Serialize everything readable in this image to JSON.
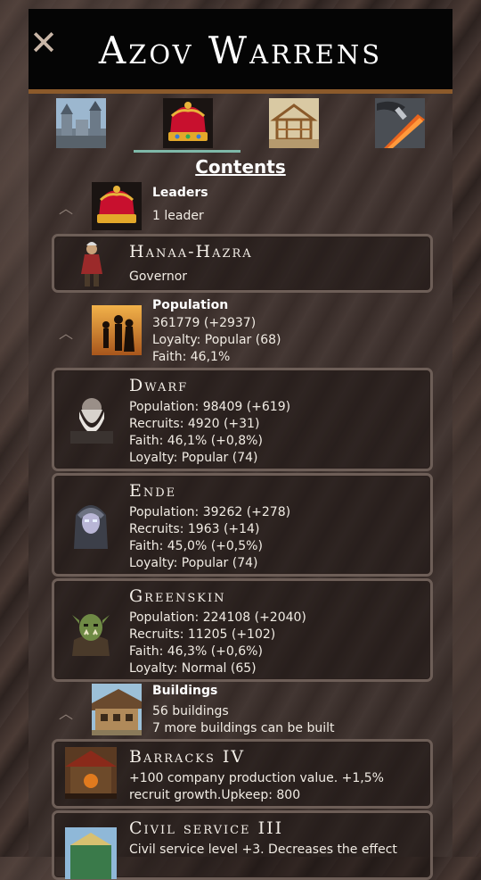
{
  "header": {
    "title": "Azov Warrens",
    "close_icon": "close-icon"
  },
  "tabs": [
    {
      "icon": "castle-icon"
    },
    {
      "icon": "crown-icon",
      "selected": true
    },
    {
      "icon": "building-frame-icon"
    },
    {
      "icon": "sword-icon"
    }
  ],
  "contents_heading": "Contents",
  "leaders": {
    "title": "Leaders",
    "summary": "1 leader",
    "items": [
      {
        "name": "Hanaa-Hazra",
        "role": "Governor"
      }
    ]
  },
  "population": {
    "title": "Population",
    "lines": [
      "361779 (+2937)",
      "Loyalty: Popular (68)",
      "Faith: 46,1%"
    ],
    "races": [
      {
        "name": "Dwarf",
        "lines": [
          "Population: 98409 (+619)",
          "Recruits: 4920 (+31)",
          "Faith: 46,1% (+0,8%)",
          "Loyalty: Popular (74)"
        ]
      },
      {
        "name": "Ende",
        "lines": [
          "Population: 39262 (+278)",
          "Recruits: 1963 (+14)",
          "Faith: 45,0% (+0,5%)",
          "Loyalty: Popular (74)"
        ]
      },
      {
        "name": "Greenskin",
        "lines": [
          "Population: 224108 (+2040)",
          "Recruits: 11205 (+102)",
          "Faith: 46,3% (+0,6%)",
          "Loyalty: Normal (65)"
        ]
      }
    ]
  },
  "buildings": {
    "title": "Buildings",
    "lines": [
      "56 buildings",
      "7 more buildings can be built"
    ],
    "items": [
      {
        "name": "Barracks IV",
        "lines": [
          "+100 company production value. +1,5%",
          "recruit growth.Upkeep: 800"
        ]
      },
      {
        "name": "Civil service III",
        "lines": [
          "Civil service level +3. Decreases the effect"
        ]
      }
    ]
  },
  "colors": {
    "accent_underline": "#7fb8a8",
    "title_border": "#8b5a2b",
    "card_border": "#6d5e57"
  }
}
